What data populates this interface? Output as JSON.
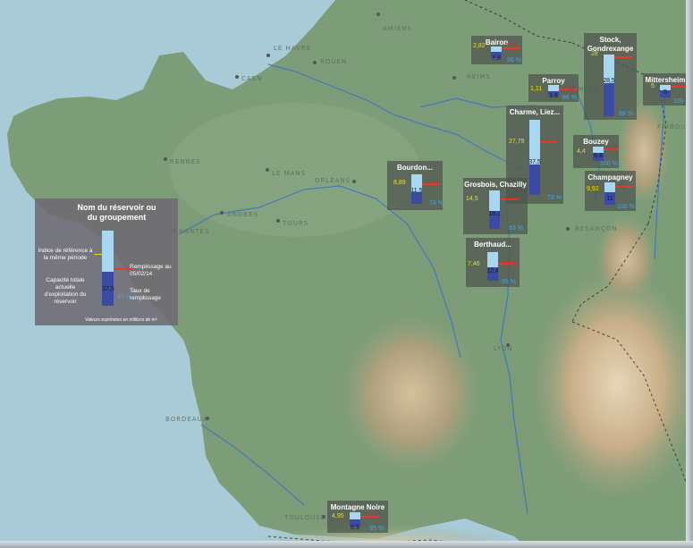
{
  "colors": {
    "sea": "#a9cbd8",
    "land": "#7d9c78",
    "relief": "#c4ab86",
    "river": "#3f74c4",
    "panel": "#4e544e",
    "tank_reference": "#a9d6f0",
    "tank_fill": "#3b4aa2",
    "text_index": "#f0e000",
    "text_current": "#d62a2a",
    "text_rate": "#4da1d9"
  },
  "cities": [
    {
      "id": "amiens",
      "label": "AMIENS"
    },
    {
      "id": "le-havre",
      "label": "LE HAVRE"
    },
    {
      "id": "rouen",
      "label": "ROUEN"
    },
    {
      "id": "caen",
      "label": "CAEN"
    },
    {
      "id": "reims",
      "label": "REIMS"
    },
    {
      "id": "rennes",
      "label": "RENNES"
    },
    {
      "id": "le-mans",
      "label": "LE MANS"
    },
    {
      "id": "orleans",
      "label": "ORLÉANS"
    },
    {
      "id": "angers",
      "label": "ANGERS"
    },
    {
      "id": "nantes",
      "label": "NANTES"
    },
    {
      "id": "tours",
      "label": "TOURS"
    },
    {
      "id": "besancon",
      "label": "BESANÇON"
    },
    {
      "id": "lyon",
      "label": "LYON"
    },
    {
      "id": "bordeaux",
      "label": "BORDEAUX"
    },
    {
      "id": "toulouse",
      "label": "TOULOUSE"
    },
    {
      "id": "fribourg",
      "label": "FRIBOURG"
    },
    {
      "id": "metz",
      "label": "METZ"
    }
  ],
  "reservoirs": [
    {
      "id": "seine-charme",
      "name": "Charme, Liez...",
      "capacity": "37,5",
      "reference": "27,79",
      "current": "27,7",
      "rate": "73 %",
      "fill_ratio": 0.73,
      "ref_ratio": 0.74
    },
    {
      "id": "bourdon",
      "name": "Bourdon...",
      "capacity": "11,5",
      "reference": "8,89",
      "current": "8,64",
      "rate": "74 %",
      "fill_ratio": 0.74,
      "ref_ratio": 0.77
    },
    {
      "id": "grosbois",
      "name": "Grosbois, Chazilly",
      "capacity": "19,1",
      "reference": "14,5",
      "current": "14,13",
      "rate": "83 %",
      "fill_ratio": 0.83,
      "ref_ratio": 0.76
    },
    {
      "id": "berthaud",
      "name": "Berthaud...",
      "capacity": "12,4",
      "reference": "7,46",
      "current": "10,4",
      "rate": "85 %",
      "fill_ratio": 0.85,
      "ref_ratio": 0.6
    },
    {
      "id": "bairon",
      "name": "Bairon",
      "capacity": "7,8",
      "reference": "2,82",
      "current": "7,53",
      "rate": "96 %",
      "fill_ratio": 0.96,
      "ref_ratio": 0.36
    },
    {
      "id": "parroy",
      "name": "Parroy",
      "capacity": "1,6",
      "reference": "1,11",
      "current": "1,56",
      "rate": "86 %",
      "fill_ratio": 0.86,
      "ref_ratio": 0.69
    },
    {
      "id": "stock-gondrexange",
      "name": "Stock, Gondrexange",
      "capacity": "28,5",
      "reference": "28",
      "current": "27,7",
      "rate": "98 %",
      "fill_ratio": 0.98,
      "ref_ratio": 0.98
    },
    {
      "id": "mittersheim",
      "name": "Mittersheim",
      "capacity": "5",
      "reference": "5",
      "current": "5",
      "rate": "100 %",
      "fill_ratio": 1.0,
      "ref_ratio": 1.0
    },
    {
      "id": "bouzey",
      "name": "Bouzey",
      "capacity": "6,8",
      "reference": "4,4",
      "current": "6,8",
      "rate": "100 %",
      "fill_ratio": 1.0,
      "ref_ratio": 0.65
    },
    {
      "id": "champagney",
      "name": "Champagney",
      "capacity": "11",
      "reference": "9,92",
      "current": "11",
      "rate": "100 %",
      "fill_ratio": 1.0,
      "ref_ratio": 0.9
    },
    {
      "id": "montagne-noire",
      "name": "Montagne Noire",
      "capacity": "6,9",
      "reference": "4,95",
      "current": "6,53",
      "rate": "95 %",
      "fill_ratio": 0.95,
      "ref_ratio": 0.72
    }
  ],
  "legend": {
    "title": "Nom du réservoir ou du groupement",
    "reference_label": "Indice de référence à la même période",
    "current_label": "Remplissage au 05/02/14",
    "capacity_label": "Capacité totale actuelle d'exploitation du réservoir",
    "rate_label": "Taux de remplissage",
    "sample_capacity": "37,5",
    "sample_rate": "45 %",
    "units_note": "Valeurs exprimées en millions de m³"
  }
}
